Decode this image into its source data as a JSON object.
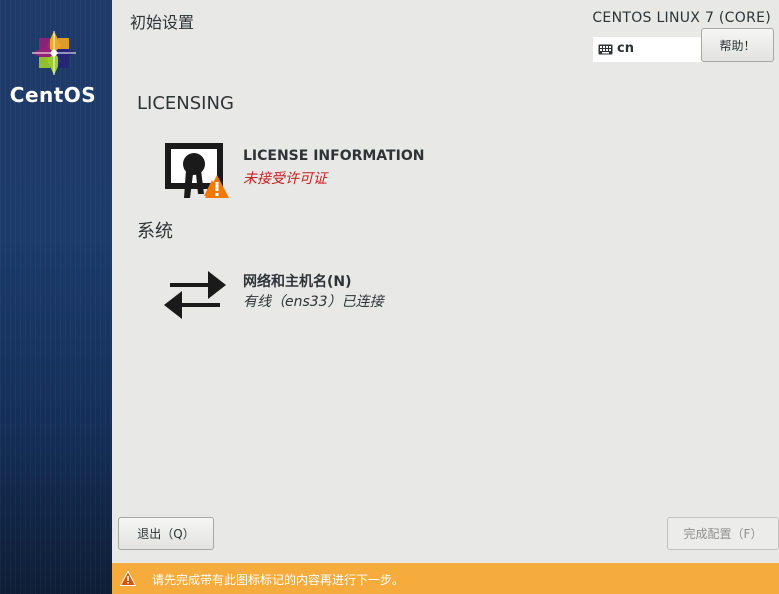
{
  "window": {
    "page_title": "初始设置",
    "product_title": "CENTOS LINUX 7 (CORE)"
  },
  "sidebar": {
    "logo_text": "CentOS",
    "logo_icon": "centos-logo-icon"
  },
  "header": {
    "keyboard_layout": "cn",
    "keyboard_icon": "keyboard-icon",
    "help_label": "帮助！"
  },
  "sections": [
    {
      "heading": "LICENSING",
      "spokes": [
        {
          "title": "LICENSE INFORMATION",
          "status": "未接受许可证",
          "icon": "license-warning-icon",
          "status_color": "#c82020"
        }
      ]
    },
    {
      "heading": "系统",
      "spokes": [
        {
          "title": "网络和主机名(N)",
          "status": "有线（ens33）已连接",
          "icon": "network-arrows-icon"
        }
      ]
    }
  ],
  "footer": {
    "quit_label": "退出（Q）",
    "finish_label": "完成配置（F）",
    "warning_text": "请先完成带有此图标标记的内容再进行下一步。",
    "warning_icon": "warning-triangle-icon",
    "warning_color": "#f6ac3c"
  }
}
